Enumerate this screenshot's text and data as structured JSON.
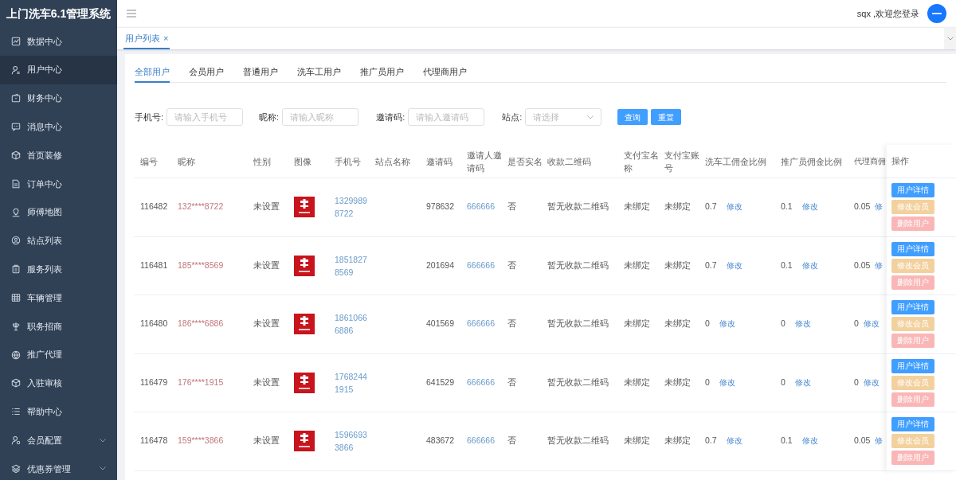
{
  "app_title": "上门洗车6.1管理系统",
  "sidebar": {
    "items": [
      {
        "label": "数据中心",
        "selected": false,
        "expandable": false
      },
      {
        "label": "用户中心",
        "selected": true,
        "expandable": false
      },
      {
        "label": "财务中心",
        "selected": false,
        "expandable": false
      },
      {
        "label": "消息中心",
        "selected": false,
        "expandable": false
      },
      {
        "label": "首页装修",
        "selected": false,
        "expandable": false
      },
      {
        "label": "订单中心",
        "selected": false,
        "expandable": false
      },
      {
        "label": "师傅地图",
        "selected": false,
        "expandable": false
      },
      {
        "label": "站点列表",
        "selected": false,
        "expandable": false
      },
      {
        "label": "服务列表",
        "selected": false,
        "expandable": false
      },
      {
        "label": "车辆管理",
        "selected": false,
        "expandable": false
      },
      {
        "label": "职务招商",
        "selected": false,
        "expandable": false
      },
      {
        "label": "推广代理",
        "selected": false,
        "expandable": false
      },
      {
        "label": "入驻审核",
        "selected": false,
        "expandable": false
      },
      {
        "label": "帮助中心",
        "selected": false,
        "expandable": false
      },
      {
        "label": "会员配置",
        "selected": false,
        "expandable": true
      },
      {
        "label": "优惠券管理",
        "selected": false,
        "expandable": true
      }
    ]
  },
  "header": {
    "welcome": "sqx ,欢迎您登录"
  },
  "page_tabs": [
    {
      "label": "用户列表",
      "selected": true,
      "closable": "×"
    }
  ],
  "user_tabs": [
    {
      "label": "全部用户",
      "selected": true
    },
    {
      "label": "会员用户",
      "selected": false
    },
    {
      "label": "普通用户",
      "selected": false
    },
    {
      "label": "洗车工用户",
      "selected": false
    },
    {
      "label": "推广员用户",
      "selected": false
    },
    {
      "label": "代理商用户",
      "selected": false
    }
  ],
  "filters": [
    {
      "kind": "input",
      "label": "手机号:",
      "placeholder": "请输入手机号"
    },
    {
      "kind": "input",
      "label": "昵称:",
      "placeholder": "请输入昵称"
    },
    {
      "kind": "input",
      "label": "邀请码:",
      "placeholder": "请输入邀请码"
    },
    {
      "kind": "select",
      "label": "站点:",
      "placeholder": "请选择"
    }
  ],
  "filter_buttons": [
    "查询",
    "重置"
  ],
  "table": {
    "columns": [
      "编号",
      "昵称",
      "性别",
      "图像",
      "手机号",
      "站点名称",
      "邀请码",
      "邀请人邀请码",
      "是否实名",
      "收款二维码",
      "支付宝名称",
      "支付宝账号",
      "洗车工佣金比例",
      "推广员佣金比例",
      "代理商佣"
    ],
    "action_column": "操作",
    "rows": [
      {
        "id": "116482",
        "nickname": "132****8722",
        "gender": "未设置",
        "phone": "13299898722",
        "invite_code": "978632",
        "inviter_code": "666666",
        "real_name": "否",
        "qr": "暂无收款二维码",
        "alipay_name": "未绑定",
        "alipay_account": "未绑定",
        "washer_ratio": "0.7",
        "washer_edit": "修改",
        "promoter_ratio": "0.1",
        "promoter_edit": "修改",
        "agent_ratio": "0.05",
        "agent_edit": "修",
        "actions": [
          "用户详情",
          "修改会员",
          "删除用户"
        ]
      },
      {
        "id": "116481",
        "nickname": "185****8569",
        "gender": "未设置",
        "phone": "18518278569",
        "invite_code": "201694",
        "inviter_code": "666666",
        "real_name": "否",
        "qr": "暂无收款二维码",
        "alipay_name": "未绑定",
        "alipay_account": "未绑定",
        "washer_ratio": "0.7",
        "washer_edit": "修改",
        "promoter_ratio": "0.1",
        "promoter_edit": "修改",
        "agent_ratio": "0.05",
        "agent_edit": "修",
        "actions": [
          "用户详情",
          "修改会员",
          "删除用户"
        ]
      },
      {
        "id": "116480",
        "nickname": "186****6886",
        "gender": "未设置",
        "phone": "18610666886",
        "invite_code": "401569",
        "inviter_code": "666666",
        "real_name": "否",
        "qr": "暂无收款二维码",
        "alipay_name": "未绑定",
        "alipay_account": "未绑定",
        "washer_ratio": "0",
        "washer_edit": "修改",
        "promoter_ratio": "0",
        "promoter_edit": "修改",
        "agent_ratio": "0",
        "agent_edit": "修改",
        "actions": [
          "用户详情",
          "修改会员",
          "删除用户"
        ]
      },
      {
        "id": "116479",
        "nickname": "176****1915",
        "gender": "未设置",
        "phone": "17682441915",
        "invite_code": "641529",
        "inviter_code": "666666",
        "real_name": "否",
        "qr": "暂无收款二维码",
        "alipay_name": "未绑定",
        "alipay_account": "未绑定",
        "washer_ratio": "0",
        "washer_edit": "修改",
        "promoter_ratio": "0",
        "promoter_edit": "修改",
        "agent_ratio": "0",
        "agent_edit": "修改",
        "actions": [
          "用户详情",
          "修改会员",
          "删除用户"
        ]
      },
      {
        "id": "116478",
        "nickname": "159****3866",
        "gender": "未设置",
        "phone": "15966933866",
        "invite_code": "483672",
        "inviter_code": "666666",
        "real_name": "否",
        "qr": "暂无收款二维码",
        "alipay_name": "未绑定",
        "alipay_account": "未绑定",
        "washer_ratio": "0.7",
        "washer_edit": "修改",
        "promoter_ratio": "0.1",
        "promoter_edit": "修改",
        "agent_ratio": "0.05",
        "agent_edit": "修",
        "actions": [
          "用户详情",
          "修改会员",
          "删除用户"
        ]
      }
    ]
  }
}
